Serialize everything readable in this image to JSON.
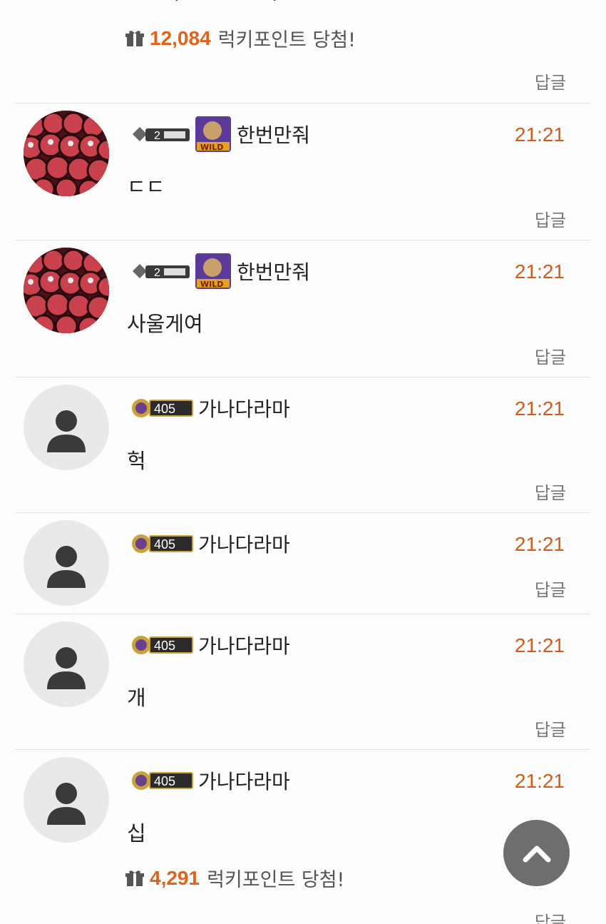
{
  "top_block": {
    "lucky_points": "12,084",
    "lucky_text": "럭키포인트 당첨!",
    "reply_label": "답글"
  },
  "comments": [
    {
      "level": "2",
      "username": "한번만줘",
      "time": "21:21",
      "body": "ㄷㄷ",
      "reply_label": "답글",
      "avatar": "photo"
    },
    {
      "level": "2",
      "username": "한번만줘",
      "time": "21:21",
      "body": "사울게여",
      "reply_label": "답글",
      "avatar": "photo"
    },
    {
      "level": "405",
      "username": "가나다라마",
      "time": "21:21",
      "body": "헉",
      "reply_label": "답글",
      "avatar": "default"
    },
    {
      "level": "405",
      "username": "가나다라마",
      "time": "21:21",
      "body": "",
      "reply_label": "답글",
      "avatar": "default"
    },
    {
      "level": "405",
      "username": "가나다라마",
      "time": "21:21",
      "body": "개",
      "reply_label": "답글",
      "avatar": "default"
    },
    {
      "level": "405",
      "username": "가나다라마",
      "time": "21:21",
      "body": "십",
      "reply_label": "답글",
      "avatar": "default",
      "lucky_points": "4,291",
      "lucky_text": "럭키포인트 당첨!"
    }
  ],
  "icons": {
    "gift": "gift-icon",
    "scroll_top": "chevron-up-icon",
    "default_avatar": "user-silhouette-icon"
  },
  "colors": {
    "accent": "#e0621d",
    "time": "#d85a1a",
    "scroll_button": "#6e6e6e"
  }
}
